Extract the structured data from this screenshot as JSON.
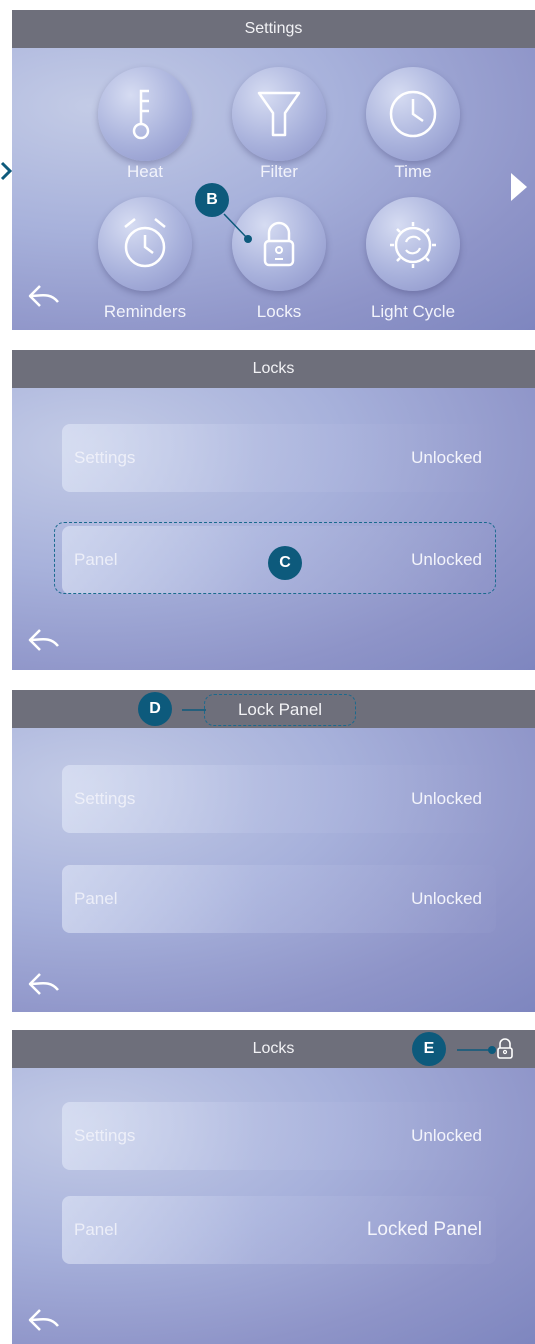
{
  "screen1": {
    "title": "Settings",
    "icons": [
      {
        "label": "Heat",
        "icon": "thermometer-icon"
      },
      {
        "label": "Filter",
        "icon": "filter-icon"
      },
      {
        "label": "Time",
        "icon": "clock-icon"
      },
      {
        "label": "Reminders",
        "icon": "alarm-clock-icon"
      },
      {
        "label": "Locks",
        "icon": "lock-icon"
      },
      {
        "label": "Light Cycle",
        "icon": "light-cycle-icon"
      }
    ],
    "callout": "B"
  },
  "screen2": {
    "title": "Locks",
    "rows": [
      {
        "label": "Settings",
        "value": "Unlocked"
      },
      {
        "label": "Panel",
        "value": "Unlocked"
      }
    ],
    "callout": "C"
  },
  "screen3": {
    "title": "Lock Panel",
    "rows": [
      {
        "label": "Settings",
        "value": "Unlocked"
      },
      {
        "label": "Panel",
        "value": "Unlocked"
      }
    ],
    "callout": "D"
  },
  "screen4": {
    "title": "Locks",
    "rows": [
      {
        "label": "Settings",
        "value": "Unlocked"
      },
      {
        "label": "Panel",
        "value": "Locked Panel"
      }
    ],
    "callout": "E",
    "status_icon": "lock-icon"
  },
  "colors": {
    "callout": "#0d5a7c",
    "titlebar": "#6e6f7b",
    "text": "#f2f3fb"
  }
}
